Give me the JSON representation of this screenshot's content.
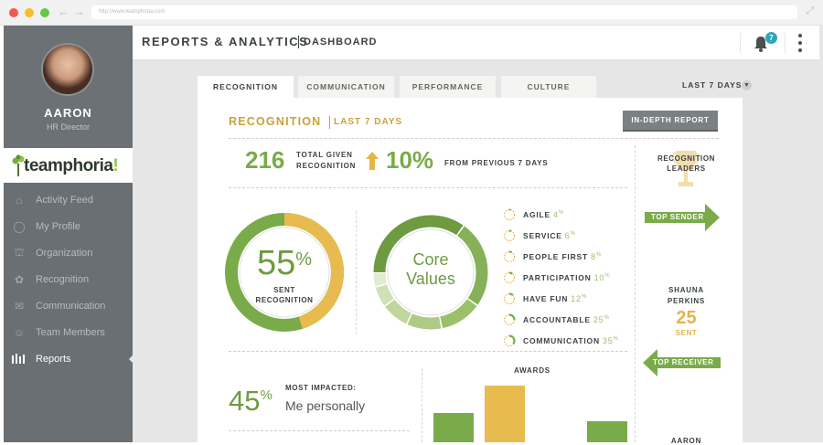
{
  "browser": {
    "url": "http://www.teamphoria.com",
    "dot_colors": [
      "#f05a52",
      "#f6bd2c",
      "#5fcb46"
    ]
  },
  "sidebar": {
    "user_name": "AARON",
    "user_role": "HR Director",
    "logo_text": "teamphoria",
    "logo_suffix": "!",
    "items": [
      {
        "label": "Activity Feed",
        "icon": "home-icon"
      },
      {
        "label": "My Profile",
        "icon": "user-circle-icon"
      },
      {
        "label": "Organization",
        "icon": "org-chart-icon"
      },
      {
        "label": "Recognition",
        "icon": "ribbon-icon"
      },
      {
        "label": "Communication",
        "icon": "chat-bubbles-icon"
      },
      {
        "label": "Team Members",
        "icon": "people-icon"
      },
      {
        "label": "Reports",
        "icon": "bar-chart-icon",
        "active": true
      }
    ]
  },
  "header": {
    "title": "REPORTS & ANALYTICS",
    "subtitle": "DASHBOARD",
    "notification_count": "7"
  },
  "tabs": [
    {
      "label": "RECOGNITION",
      "active": true
    },
    {
      "label": "COMMUNICATION"
    },
    {
      "label": "PERFORMANCE"
    },
    {
      "label": "CULTURE"
    }
  ],
  "range_select": "LAST 7 DAYS",
  "report": {
    "title": "RECOGNITION",
    "subtitle": "LAST 7 DAYS",
    "in_depth_button": "IN-DEPTH REPORT",
    "total_given": "216",
    "total_given_label_1": "TOTAL GIVEN",
    "total_given_label_2": "RECOGNITION",
    "change_pct": "10%",
    "change_label": "FROM PREVIOUS 7 DAYS",
    "sent_pct_value": "55",
    "sent_pct_symbol": "%",
    "sent_label_1": "SENT",
    "sent_label_2": "RECOGNITION",
    "sent_fraction": 0.55,
    "core_values_1": "Core",
    "core_values_2": "Values",
    "values": [
      {
        "label": "AGILE",
        "pct": "4",
        "fraction": 0.04
      },
      {
        "label": "SERVICE",
        "pct": "6",
        "fraction": 0.06
      },
      {
        "label": "PEOPLE FIRST",
        "pct": "8",
        "fraction": 0.08
      },
      {
        "label": "PARTICIPATION",
        "pct": "10",
        "fraction": 0.1
      },
      {
        "label": "HAVE FUN",
        "pct": "12",
        "fraction": 0.12
      },
      {
        "label": "ACCOUNTABLE",
        "pct": "25",
        "fraction": 0.25
      },
      {
        "label": "COMMUNICATION",
        "pct": "35",
        "fraction": 0.35
      }
    ],
    "most_impacted_pct": "45",
    "most_impacted_symbol": "%",
    "most_impacted_label": "MOST IMPACTED:",
    "most_impacted_value": "Me personally",
    "awards_title": "AWARDS",
    "leaders_1": "RECOGNITION",
    "leaders_2": "LEADERS",
    "top_sender": "TOP SENDER",
    "top_sender_name_1": "SHAUNA",
    "top_sender_name_2": "PERKINS",
    "top_sender_count": "25",
    "top_sender_unit": "SENT",
    "top_receiver": "TOP RECEIVER",
    "top_receiver_name": "AARON"
  },
  "colors": {
    "green": "#7aab4a",
    "gold": "#e3b54a",
    "title_gold": "#c9a33a",
    "sidebar": "#696f72"
  }
}
